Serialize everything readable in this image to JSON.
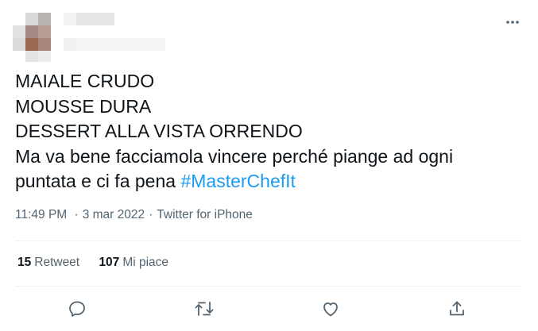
{
  "tweet": {
    "text_lines": [
      "MAIALE CRUDO",
      "MOUSSE DURA",
      "DESSERT ALLA VISTA ORRENDO",
      "Ma va bene facciamola vincere perché piange ad ogni",
      "puntata e ci fa pena"
    ],
    "hashtag": "#MasterChefIt",
    "time": "11:49 PM",
    "date": "3 mar 2022",
    "source": "Twitter for iPhone",
    "separator": "·"
  },
  "stats": {
    "retweets_count": "15",
    "retweets_label": "Retweet",
    "likes_count": "107",
    "likes_label": "Mi piace"
  },
  "icons": {
    "more": "more-horizontal-icon",
    "reply": "reply-icon",
    "retweet": "retweet-icon",
    "like": "heart-icon",
    "share": "share-icon"
  },
  "colors": {
    "text": "#0f1419",
    "secondary": "#536471",
    "link": "#1d9bf0",
    "divider": "#eff3f4"
  }
}
